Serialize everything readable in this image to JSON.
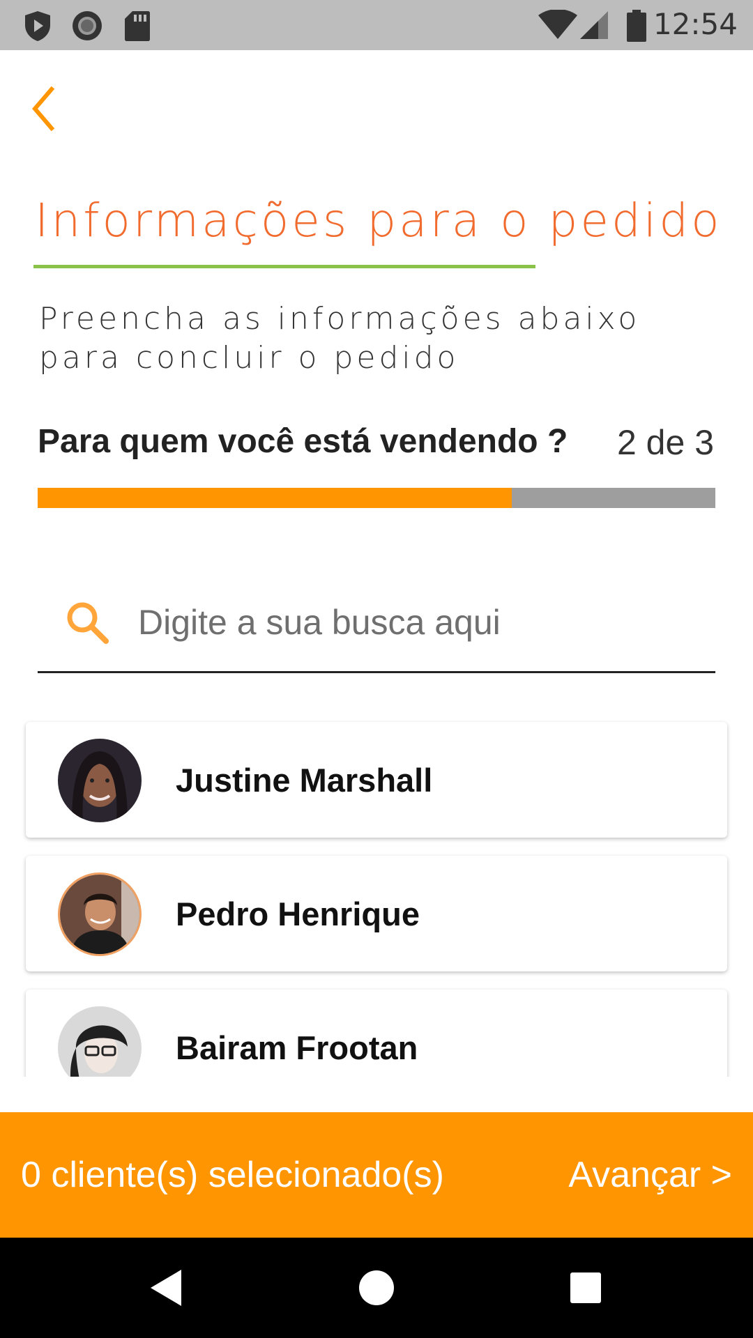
{
  "status_bar": {
    "time": "12:54",
    "icons": [
      "shield-play-icon",
      "circle-record-icon",
      "sd-card-icon",
      "wifi-icon",
      "signal-icon",
      "battery-icon"
    ]
  },
  "header": {
    "back_icon": "chevron-left-icon",
    "title": "Informações para o pedido",
    "subtitle": "Preencha as informações abaixo para concluir o pedido"
  },
  "step": {
    "question": "Para quem você está vendendo ?",
    "counter": "2 de 3",
    "progress_fraction": 0.7
  },
  "search": {
    "placeholder": "Digite a sua busca aqui",
    "value": ""
  },
  "clients": [
    {
      "name": "Justine Marshall"
    },
    {
      "name": "Pedro Henrique"
    },
    {
      "name": "Bairam Frootan"
    }
  ],
  "footer": {
    "selected_text": "0 cliente(s) selecionado(s)",
    "next_label": "Avançar >"
  },
  "colors": {
    "accent": "#ff9500",
    "title": "#f26b2e",
    "underline": "#8bc34a",
    "progress_track": "#9e9e9e"
  },
  "nav_bar": {
    "icons": [
      "back-triangle-icon",
      "home-circle-icon",
      "recents-square-icon"
    ]
  }
}
